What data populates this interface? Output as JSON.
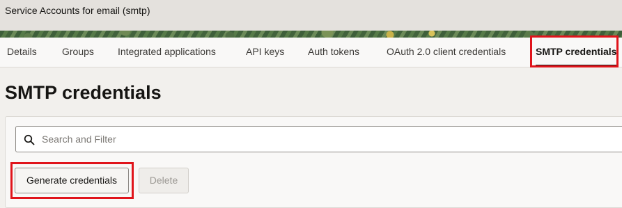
{
  "window": {
    "title": "Service Accounts for email (smtp)"
  },
  "tabs": [
    {
      "label": "Details"
    },
    {
      "label": "Groups"
    },
    {
      "label": "Integrated applications"
    },
    {
      "label": "API keys"
    },
    {
      "label": "Auth tokens"
    },
    {
      "label": "OAuth 2.0 client credentials"
    },
    {
      "label": "SMTP credentials",
      "active": true
    }
  ],
  "main": {
    "title": "SMTP credentials",
    "search": {
      "placeholder": "Search and Filter",
      "value": ""
    },
    "buttons": {
      "generate": "Generate credentials",
      "delete": "Delete"
    }
  },
  "colors": {
    "highlight": "#e0141b",
    "active_tab_underline": "#161513"
  },
  "icons": {
    "search": "search-icon"
  }
}
